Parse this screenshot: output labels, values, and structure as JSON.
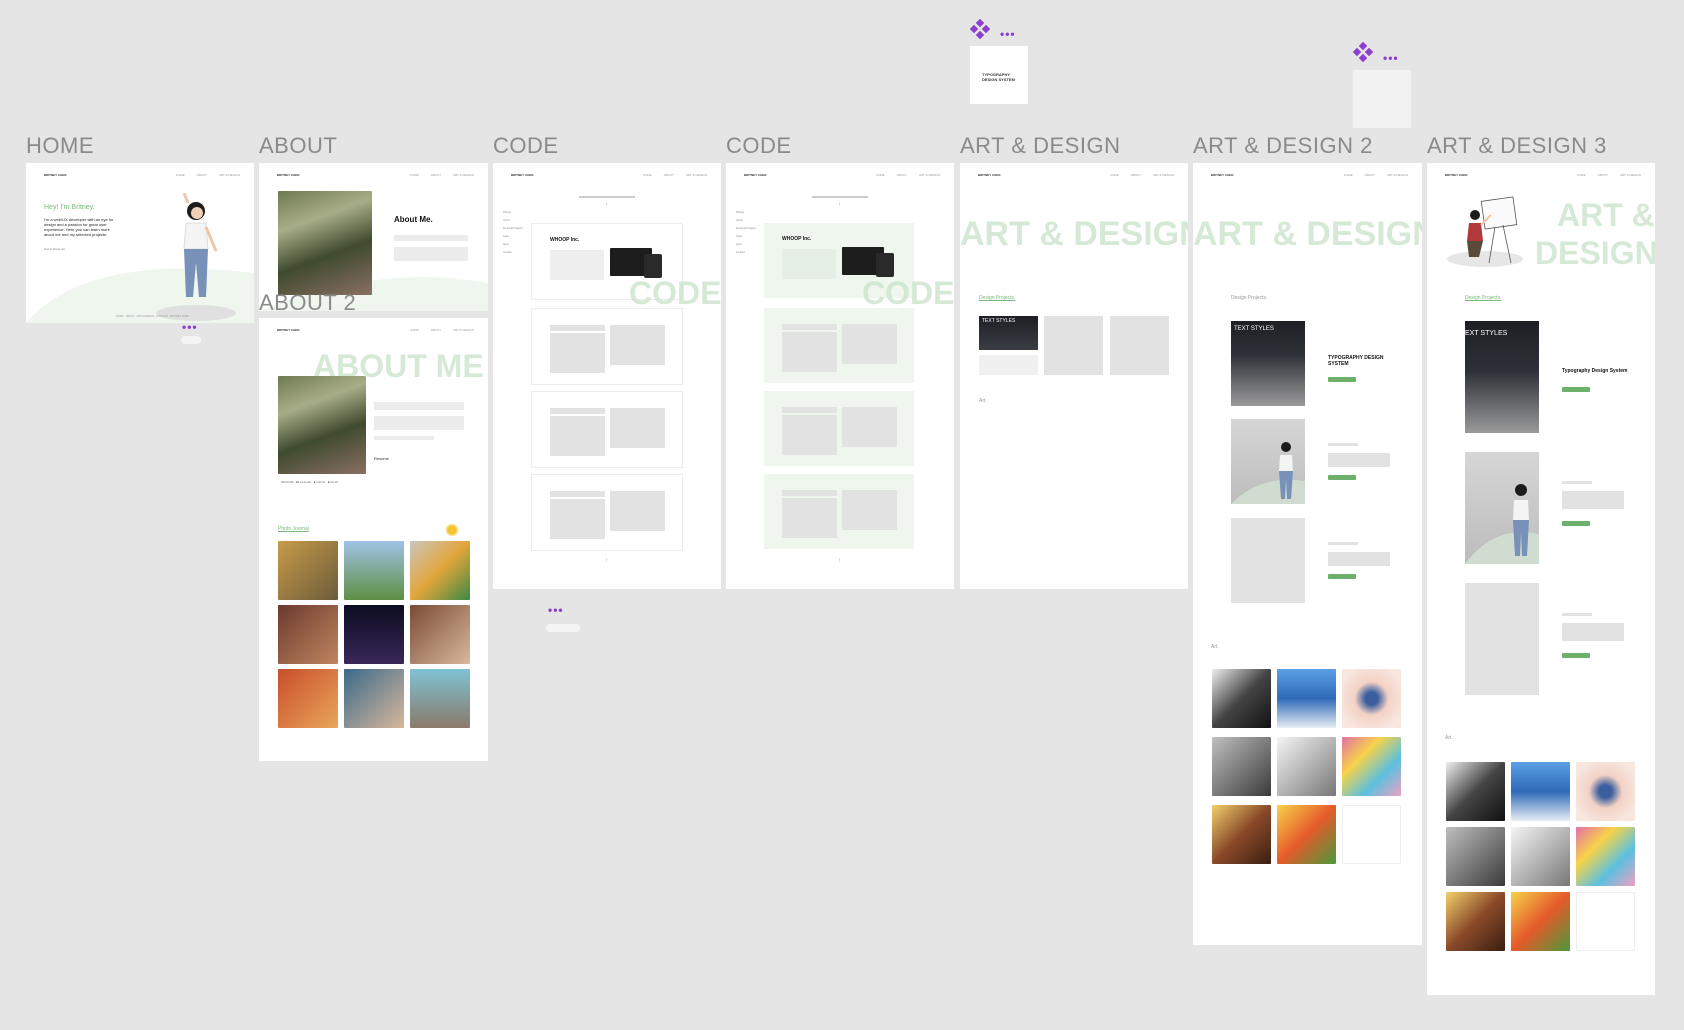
{
  "frames": {
    "home": {
      "label": "HOME",
      "logo": "BRITNEY CHEN",
      "nav": [
        "CODE",
        "ABOUT",
        "ART & DESIGN"
      ],
      "greeting": "Hey! I'm Britney.",
      "intro": "I'm a web/UX developer with an eye for design and a passion for great user experience. Here you can learn more about me and my selected projects.",
      "cta": "Get to know me",
      "footer": "WORK · ABOUT · ART & DESIGN · CONTACT · BRITNEY CHEN"
    },
    "about": {
      "label": "ABOUT",
      "logo": "BRITNEY CHEN",
      "nav": [
        "CODE",
        "ABOUT",
        "ART & DESIGN"
      ],
      "heading": "About Me."
    },
    "about2": {
      "label": "ABOUT 2",
      "logo": "BRITNEY CHEN",
      "nav": [
        "CODE",
        "ABOUT",
        "ART & DESIGN"
      ],
      "watermark": "ABOUT ME",
      "resume": "Resume",
      "social": [
        "RESUME",
        "LinkedIn",
        "Github",
        "Email"
      ],
      "photos_label": "Photo Journal"
    },
    "code1": {
      "label": "CODE",
      "logo": "BRITNEY CHEN",
      "nav": [
        "CODE",
        "ABOUT",
        "ART & DESIGN"
      ],
      "watermark": "CODE",
      "project": "WHOOP Inc.",
      "side": [
        "Whoop",
        "Oscar",
        "Personal Projects",
        "Team",
        "Apps",
        "Contact"
      ]
    },
    "code2": {
      "label": "CODE",
      "logo": "BRITNEY CHEN",
      "nav": [
        "CODE",
        "ABOUT",
        "ART & DESIGN"
      ],
      "watermark": "CODE",
      "project": "WHOOP Inc.",
      "side": [
        "Whoop",
        "Oscar",
        "Personal Projects",
        "Team",
        "Apps",
        "Contact"
      ]
    },
    "art1": {
      "label": "ART & DESIGN",
      "logo": "BRITNEY CHEN",
      "nav": [
        "CODE",
        "ABOUT",
        "ART & DESIGN"
      ],
      "watermark": "ART & DESIGN",
      "design_projects": "Design Projects.",
      "art": "Art.",
      "text_styles": "TEXT STYLES"
    },
    "art2": {
      "label": "ART & DESIGN 2",
      "logo": "BRITNEY CHEN",
      "nav": [
        "CODE",
        "ABOUT",
        "ART & DESIGN"
      ],
      "watermark": "ART & DESIGN",
      "design_projects": "Design Projects.",
      "art": "Art.",
      "text_styles": "TEXT STYLES",
      "project_title": "TYPOGRAPHY DESIGN SYSTEM"
    },
    "art3": {
      "label": "ART & DESIGN 3",
      "logo": "BRITNEY CHEN",
      "nav": [
        "CODE",
        "ABOUT",
        "ART & DESIGN"
      ],
      "watermark_line1": "ART &",
      "watermark_line2": "DESIGN",
      "design_projects": "Design Projects.",
      "art": "Art.",
      "text_styles": "EXT STYLES",
      "project_title": "Typography Design System"
    }
  },
  "component": {
    "title": "TYPOGRAPHY DESIGN SYSTEM"
  },
  "colors": {
    "accent": "#6cb06c",
    "watermark": "#cfe6cf",
    "component": "#8a3fd1",
    "canvas": "#e5e5e5"
  }
}
